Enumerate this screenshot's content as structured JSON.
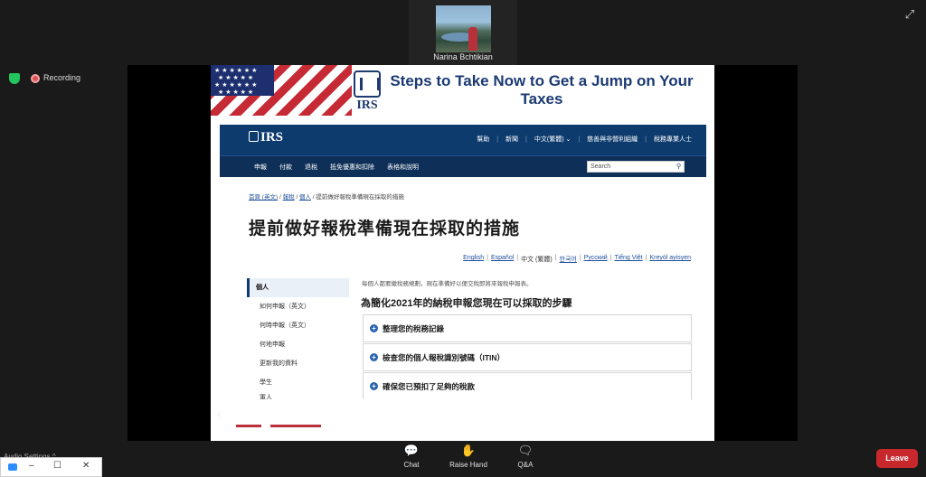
{
  "participant": {
    "name": "Narina   Bchtikian"
  },
  "recording": {
    "label": "Recording"
  },
  "slide": {
    "headline": "Steps to Take Now to Get a Jump on Your Taxes",
    "logo_text": "IRS"
  },
  "irs_site": {
    "logo": "IRS",
    "top_links": [
      "幫助",
      "新聞",
      "中文(繁體) ⌄",
      "慈善與非營利組織",
      "稅務專業人士"
    ],
    "nav": [
      "申報",
      "付款",
      "退稅",
      "抵免優惠和扣除",
      "表格和說明"
    ],
    "search_placeholder": "Search",
    "breadcrumb": {
      "home": "首頁 (英文)",
      "b2": "報稅",
      "b3": "個人",
      "current": "提前做好報稅準備現在採取的措施"
    },
    "page_title": "提前做好報稅準備現在採取的措施",
    "languages": {
      "en": "English",
      "es": "Español",
      "zh": "中文 (繁體)",
      "ko": "한국어",
      "ru": "Русский",
      "vi": "Tiếng Việt",
      "ht": "Kreyòl ayisyen"
    },
    "menu": [
      "個人",
      "如何申報（英文）",
      "何時申報（英文）",
      "何地申報",
      "更新我的資料",
      "學生",
      "軍人"
    ],
    "intro": "每個人都要繳稅務規劃，現在準備好以便交稅即將來報稅申報表。",
    "section_heading": "為簡化2021年的納稅申報您現在可以採取的步驟",
    "accordions": [
      "整理您的稅務記錄",
      "檢查您的個人報稅識別號碼（ITIN）",
      "確保您已預扣了足夠的稅款"
    ]
  },
  "toolbar": {
    "chat": "Chat",
    "raise_hand": "Raise Hand",
    "qa": "Q&A",
    "leave": "Leave"
  },
  "mini_window": {
    "audio_hint": "Audio Settings ^"
  }
}
